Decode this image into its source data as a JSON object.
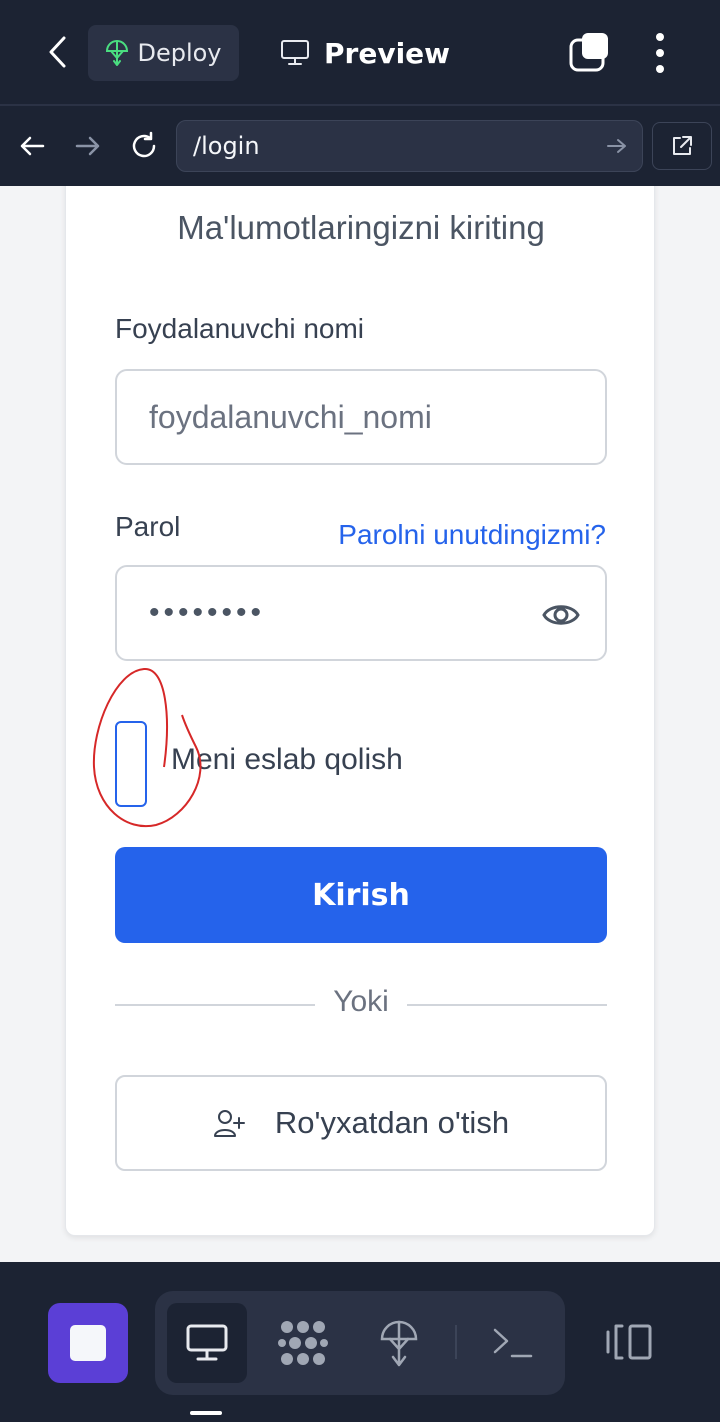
{
  "topbar": {
    "deploy_label": "Deploy",
    "preview_label": "Preview"
  },
  "urlbar": {
    "url": "/login"
  },
  "form": {
    "title": "Ma'lumotlaringizni kiriting",
    "username_label": "Foydalanuvchi nomi",
    "username_placeholder": "foydalanuvchi_nomi",
    "password_label": "Parol",
    "forgot_link": "Parolni unutdingizmi?",
    "password_value": "••••••••",
    "remember_label": "Meni eslab qolish",
    "remember_checked": false,
    "login_button": "Kirish",
    "divider_text": "Yoki",
    "signup_button": "Ro'yxatdan o'tish"
  },
  "colors": {
    "bar_bg": "#1c2333",
    "primary": "#2563eb",
    "home_accent": "#5b3fd6",
    "annotation": "#d62828"
  },
  "icons": {
    "top": [
      "chevron-left-icon",
      "deploy-icon",
      "monitor-icon",
      "tabs-icon",
      "kebab-icon"
    ],
    "url": [
      "arrow-left-icon",
      "arrow-right-icon",
      "refresh-icon",
      "go-arrow-icon",
      "external-link-icon"
    ],
    "bottom": [
      "stop-icon",
      "monitor-icon",
      "packages-icon",
      "deploy-icon",
      "terminal-icon",
      "layout-icon"
    ]
  }
}
